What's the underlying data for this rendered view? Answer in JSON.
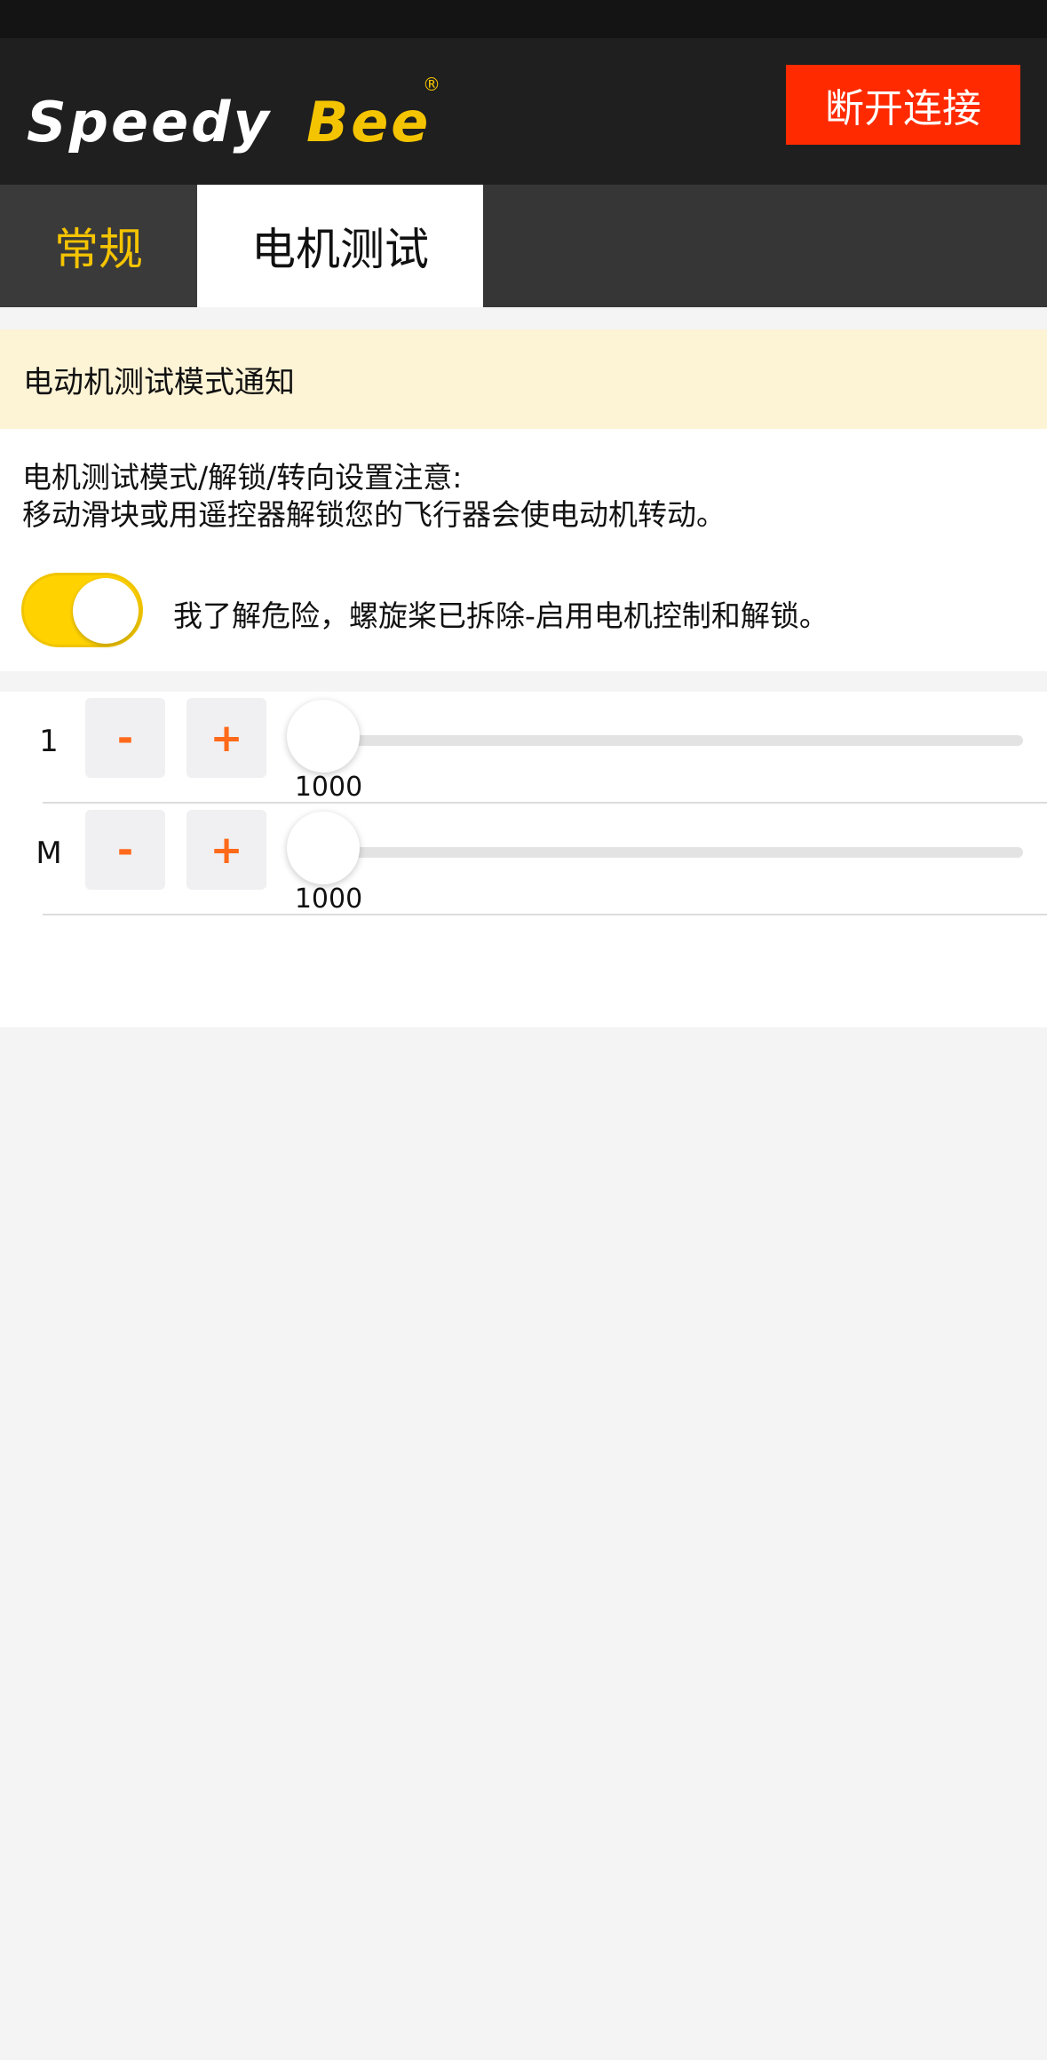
{
  "header": {
    "logo_part1": "Speedy",
    "logo_part2": "Bee",
    "logo_mark": "®",
    "disconnect_label": "断开连接",
    "accent_color": "#f5c400",
    "disconnect_color": "#ff2a00"
  },
  "tabs": [
    {
      "label": "常规",
      "active": false
    },
    {
      "label": "电机测试",
      "active": true
    }
  ],
  "notice": {
    "title": "电动机测试模式通知",
    "line1": "电机测试模式/解锁/转向设置注意:",
    "line2": "移动滑块或用遥控器解锁您的飞行器会使电动机转动。",
    "toggle_on": true,
    "acknowledge": "我了解危险，螺旋桨已拆除-启用电机控制和解锁。"
  },
  "motors": [
    {
      "label": "1",
      "minus": "-",
      "plus": "+",
      "value": "1000"
    },
    {
      "label": "M",
      "minus": "-",
      "plus": "+",
      "value": "1000"
    }
  ],
  "icons": {
    "toggle": "toggle-switch-icon",
    "slider_knob": "slider-thumb-icon"
  }
}
